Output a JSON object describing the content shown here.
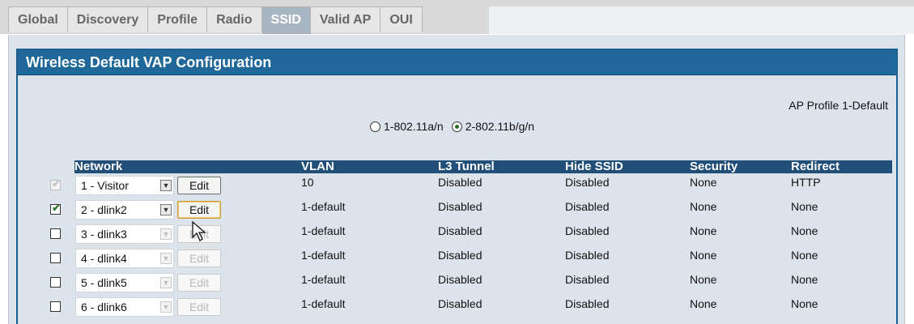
{
  "tabs": [
    "Global",
    "Discovery",
    "Profile",
    "Radio",
    "SSID",
    "Valid AP",
    "OUI"
  ],
  "active_tab": "SSID",
  "panel": {
    "title": "Wireless Default VAP Configuration",
    "profile_label": "AP Profile 1-Default",
    "radios": [
      {
        "label": "1-802.11a/n",
        "checked": false
      },
      {
        "label": "2-802.11b/g/n",
        "checked": true
      }
    ]
  },
  "table": {
    "headers": {
      "network": "Network",
      "vlan": "VLAN",
      "l3tunnel": "L3 Tunnel",
      "hidessid": "Hide SSID",
      "security": "Security",
      "redirect": "Redirect"
    },
    "rows": [
      {
        "checked": true,
        "check_disabled": true,
        "network": "1 - Visitor",
        "edit": "Edit",
        "enabled": true,
        "vlan": "10",
        "l3tunnel": "Disabled",
        "hidessid": "Disabled",
        "security": "None",
        "redirect": "HTTP"
      },
      {
        "checked": true,
        "check_disabled": false,
        "network": "2 - dlink2",
        "edit": "Edit",
        "enabled": true,
        "vlan": "1-default",
        "l3tunnel": "Disabled",
        "hidessid": "Disabled",
        "security": "None",
        "redirect": "None"
      },
      {
        "checked": false,
        "check_disabled": false,
        "network": "3 - dlink3",
        "edit": "Edit",
        "enabled": false,
        "vlan": "1-default",
        "l3tunnel": "Disabled",
        "hidessid": "Disabled",
        "security": "None",
        "redirect": "None"
      },
      {
        "checked": false,
        "check_disabled": false,
        "network": "4 - dlink4",
        "edit": "Edit",
        "enabled": false,
        "vlan": "1-default",
        "l3tunnel": "Disabled",
        "hidessid": "Disabled",
        "security": "None",
        "redirect": "None"
      },
      {
        "checked": false,
        "check_disabled": false,
        "network": "5 - dlink5",
        "edit": "Edit",
        "enabled": false,
        "vlan": "1-default",
        "l3tunnel": "Disabled",
        "hidessid": "Disabled",
        "security": "None",
        "redirect": "None"
      },
      {
        "checked": false,
        "check_disabled": false,
        "network": "6 - dlink6",
        "edit": "Edit",
        "enabled": false,
        "vlan": "1-default",
        "l3tunnel": "Disabled",
        "hidessid": "Disabled",
        "security": "None",
        "redirect": "None"
      }
    ]
  },
  "colors": {
    "title_bar": "#1f6899",
    "header_bar": "#224f78",
    "panel_bg": "#dde3ea",
    "active_tab": "#a8b6c4"
  }
}
